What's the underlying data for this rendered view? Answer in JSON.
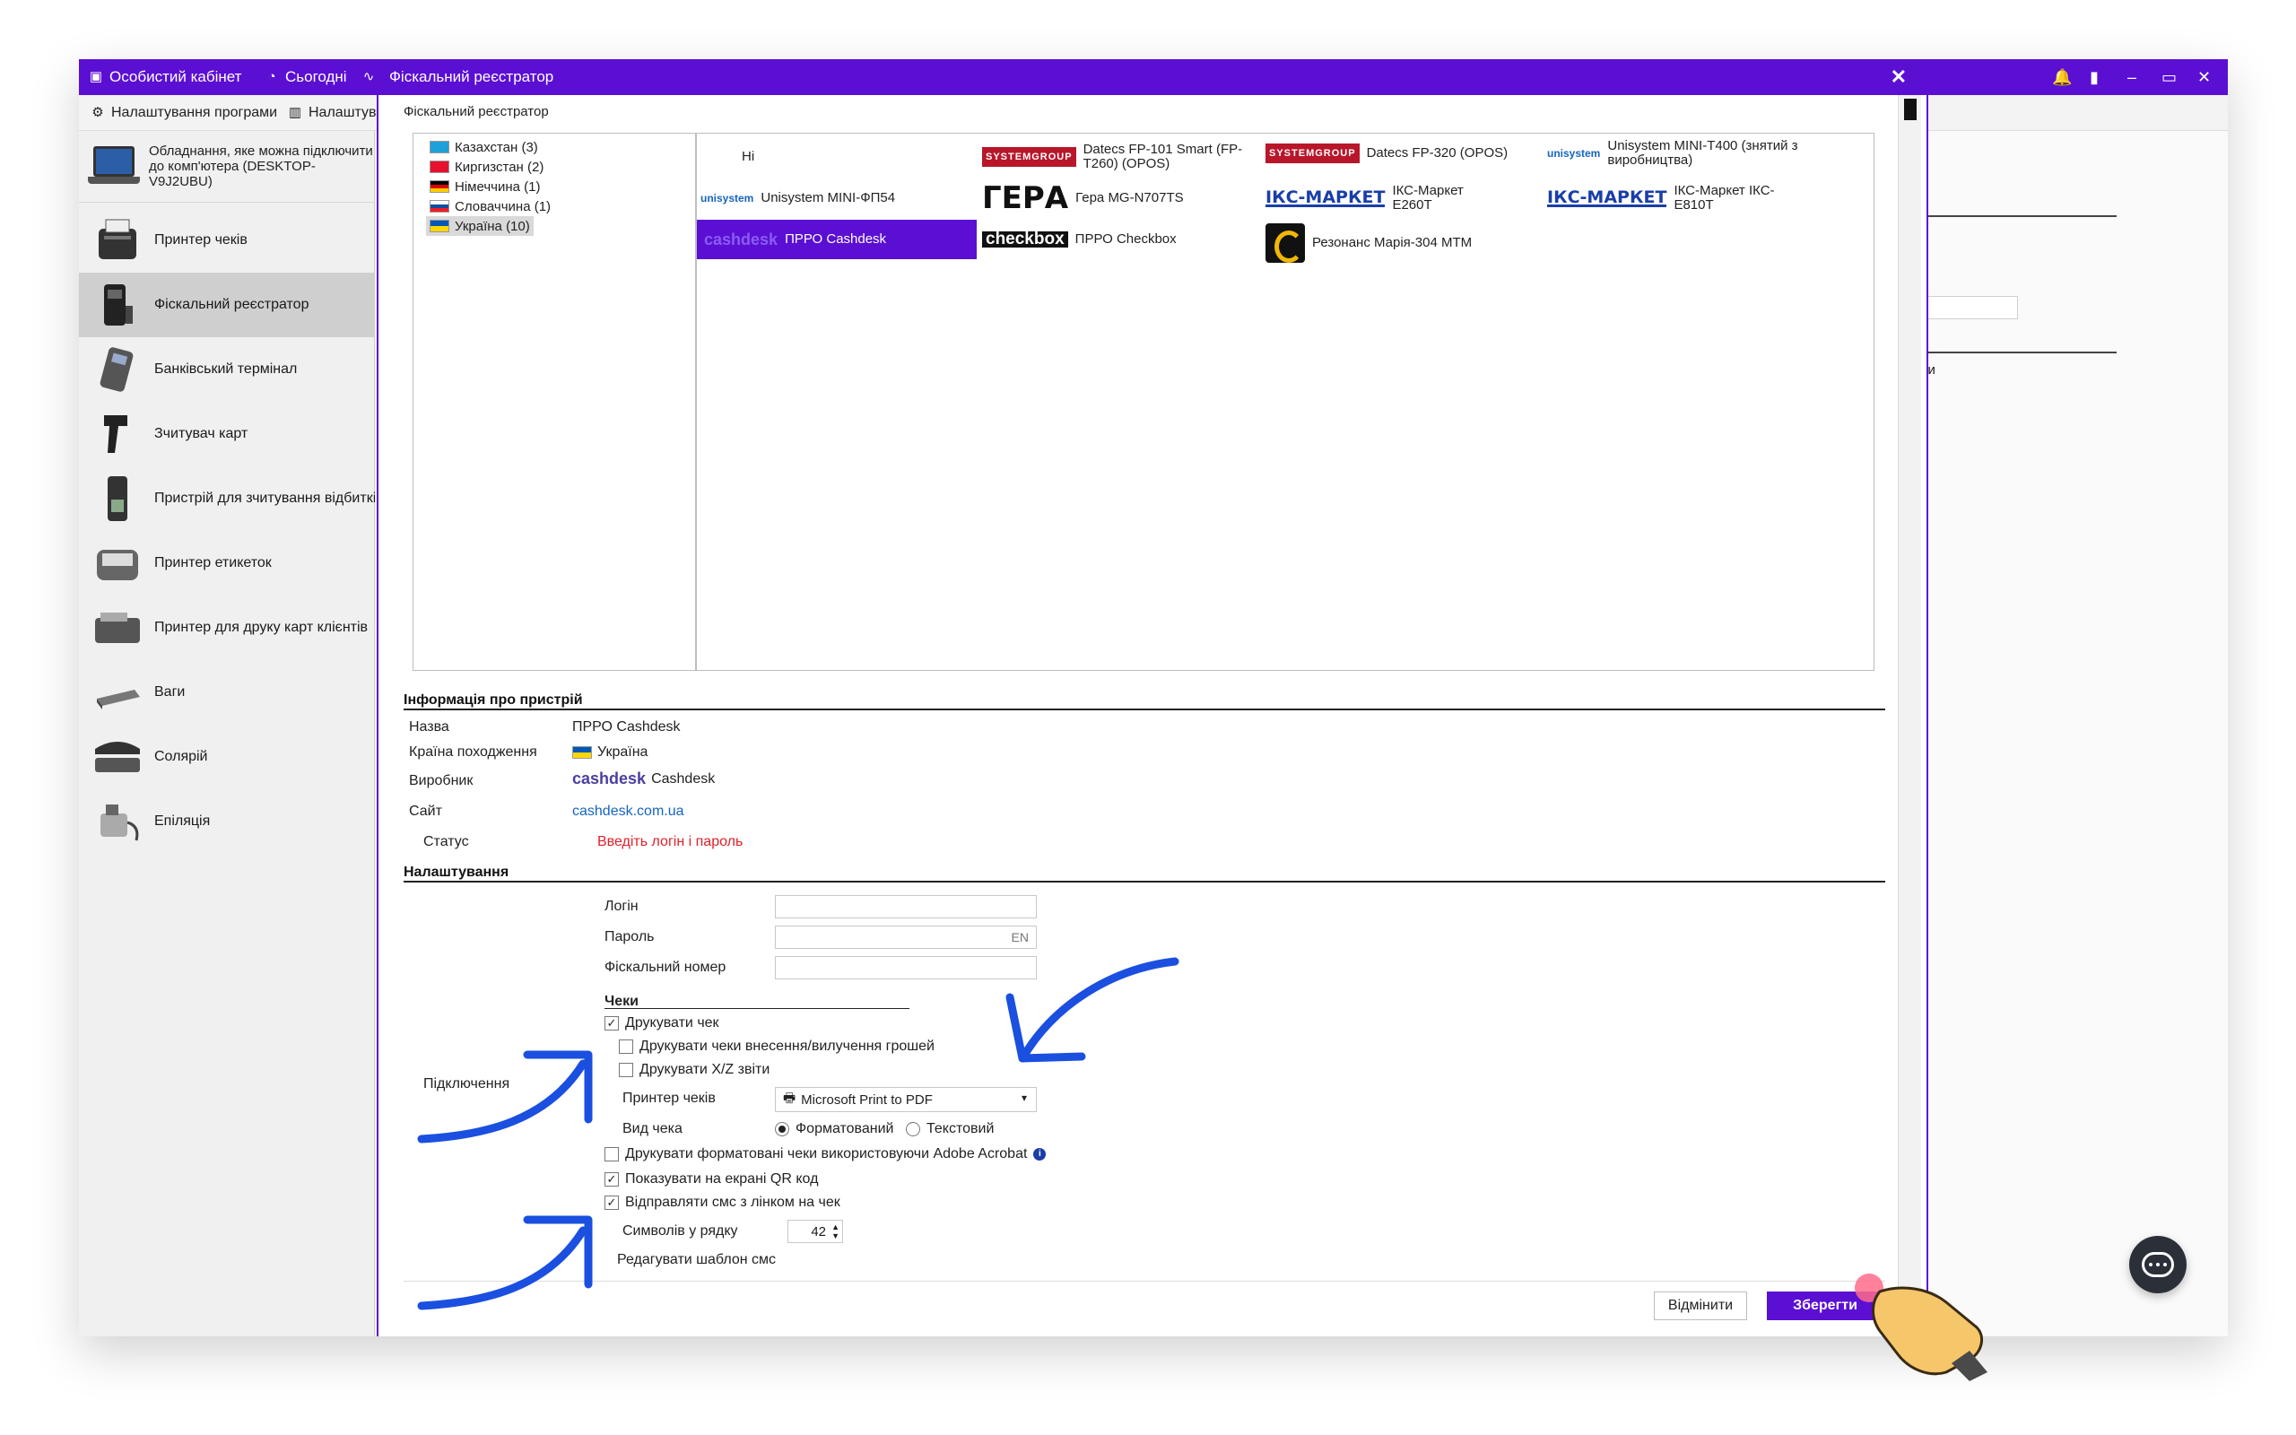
{
  "app": {
    "titlebar": {
      "account": "Особистий кабінет",
      "today": "Сьогодні"
    },
    "toolbar": {
      "settings": "Налаштування програми",
      "settings2": "Налаштув"
    },
    "sidebar": {
      "header": "Обладнання, яке можна підключити до комп'ютера (DESKTOP-V9J2UBU)",
      "items": [
        {
          "label": "Принтер чеків",
          "icon": "receipt-printer-icon"
        },
        {
          "label": "Фіскальний реєстратор",
          "icon": "fiscal-register-icon"
        },
        {
          "label": "Банківський термінал",
          "icon": "bank-terminal-icon"
        },
        {
          "label": "Зчитувач карт",
          "icon": "card-reader-icon"
        },
        {
          "label": "Пристрій для зчитування відбитків",
          "icon": "fingerprint-reader-icon"
        },
        {
          "label": "Принтер етикеток",
          "icon": "label-printer-icon"
        },
        {
          "label": "Принтер для друку карт клієнтів",
          "icon": "card-printer-icon"
        },
        {
          "label": "Ваги",
          "icon": "scales-icon"
        },
        {
          "label": "Солярій",
          "icon": "solarium-icon"
        },
        {
          "label": "Епіляція",
          "icon": "epilation-icon"
        }
      ]
    },
    "bg_pane": {
      "fragment": "ги"
    }
  },
  "dialog": {
    "title": "Фіскальний реєстратор",
    "subtitle": "Фіскальний реєстратор",
    "countries": [
      {
        "label": "Казахстан (3)",
        "flag": "#1ea0d8"
      },
      {
        "label": "Киргизстан (2)",
        "flag": "#e8112d"
      },
      {
        "label": "Німеччина (1)",
        "flag": "#dd0000"
      },
      {
        "label": "Словаччина (1)",
        "flag": "#0b4ea2"
      },
      {
        "label": "Україна (10)",
        "flag": "#0057b7"
      }
    ],
    "devices": [
      {
        "label": "Ні",
        "logo": ""
      },
      {
        "label": "Datecs FP-101 Smart (FP-T260) (OPOS)",
        "logo": "SYSTEMGROUP"
      },
      {
        "label": "Datecs FP-320 (OPOS)",
        "logo": "SYSTEMGROUP"
      },
      {
        "label": "Unisystem MINI-T400 (знятий з виробництва)",
        "logo": "unisystem"
      },
      {
        "label": "Unisystem MINI-ФП54",
        "logo": "unisystem"
      },
      {
        "label": "Гера MG-N707TS",
        "logo": "ГЕРА"
      },
      {
        "label": "ІКС-Маркет Е260Т",
        "logo": "ІКС-МАРКЕТ"
      },
      {
        "label": "ІКС-Маркет ІКС-Е810Т",
        "logo": "ІКС-МАРКЕТ"
      },
      {
        "label": "ПРРО Cashdesk",
        "logo": "cashdesk"
      },
      {
        "label": "ПРРО Checkbox",
        "logo": "checkbox"
      },
      {
        "label": "Резонанс Марія-304 МТМ",
        "logo": ""
      }
    ],
    "info": {
      "heading": "Інформація про пристрій",
      "name_label": "Назва",
      "name_value": "ПРРО Cashdesk",
      "country_label": "Країна походження",
      "country_value": "Україна",
      "maker_label": "Виробник",
      "maker_logo": "cashdesk",
      "maker_value": "Cashdesk",
      "site_label": "Сайт",
      "site_value": "cashdesk.com.ua",
      "status_label": "Статус",
      "status_value": "Введіть логін і пароль"
    },
    "settings": {
      "heading": "Налаштування",
      "connection_label": "Підключення",
      "login_label": "Логін",
      "login_value": "",
      "password_label": "Пароль",
      "password_lang": "EN",
      "fiscal_label": "Фіскальний номер",
      "fiscal_value": "",
      "receipts_heading": "Чеки",
      "print_receipt": {
        "label": "Друкувати чек",
        "checked": true
      },
      "print_cash_io": {
        "label": "Друкувати чеки внесення/вилучення грошей",
        "checked": false
      },
      "print_xz": {
        "label": "Друкувати X/Z звіти",
        "checked": false
      },
      "printer_label": "Принтер чеків",
      "printer_value": "Microsoft Print to PDF",
      "view_label": "Вид чека",
      "view_formatted": "Форматований",
      "view_text": "Текстовий",
      "view_selected": "Форматований",
      "print_acrobat": {
        "label": "Друкувати форматовані чеки використовуючи Adobe Acrobat",
        "checked": false
      },
      "show_qr": {
        "label": "Показувати на екрані QR код",
        "checked": true
      },
      "send_sms": {
        "label": "Відправляти смс з лінком на чек",
        "checked": true
      },
      "chars_label": "Символів у рядку",
      "chars_value": "42",
      "edit_sms_label": "Редагувати шаблон смс"
    },
    "buttons": {
      "cancel": "Відмінити",
      "save": "Зберегти"
    }
  },
  "colors": {
    "accent": "#5b0fd3",
    "annotation_arrow": "#1a4fe0",
    "error": "#e0202a",
    "link": "#1565c0"
  }
}
